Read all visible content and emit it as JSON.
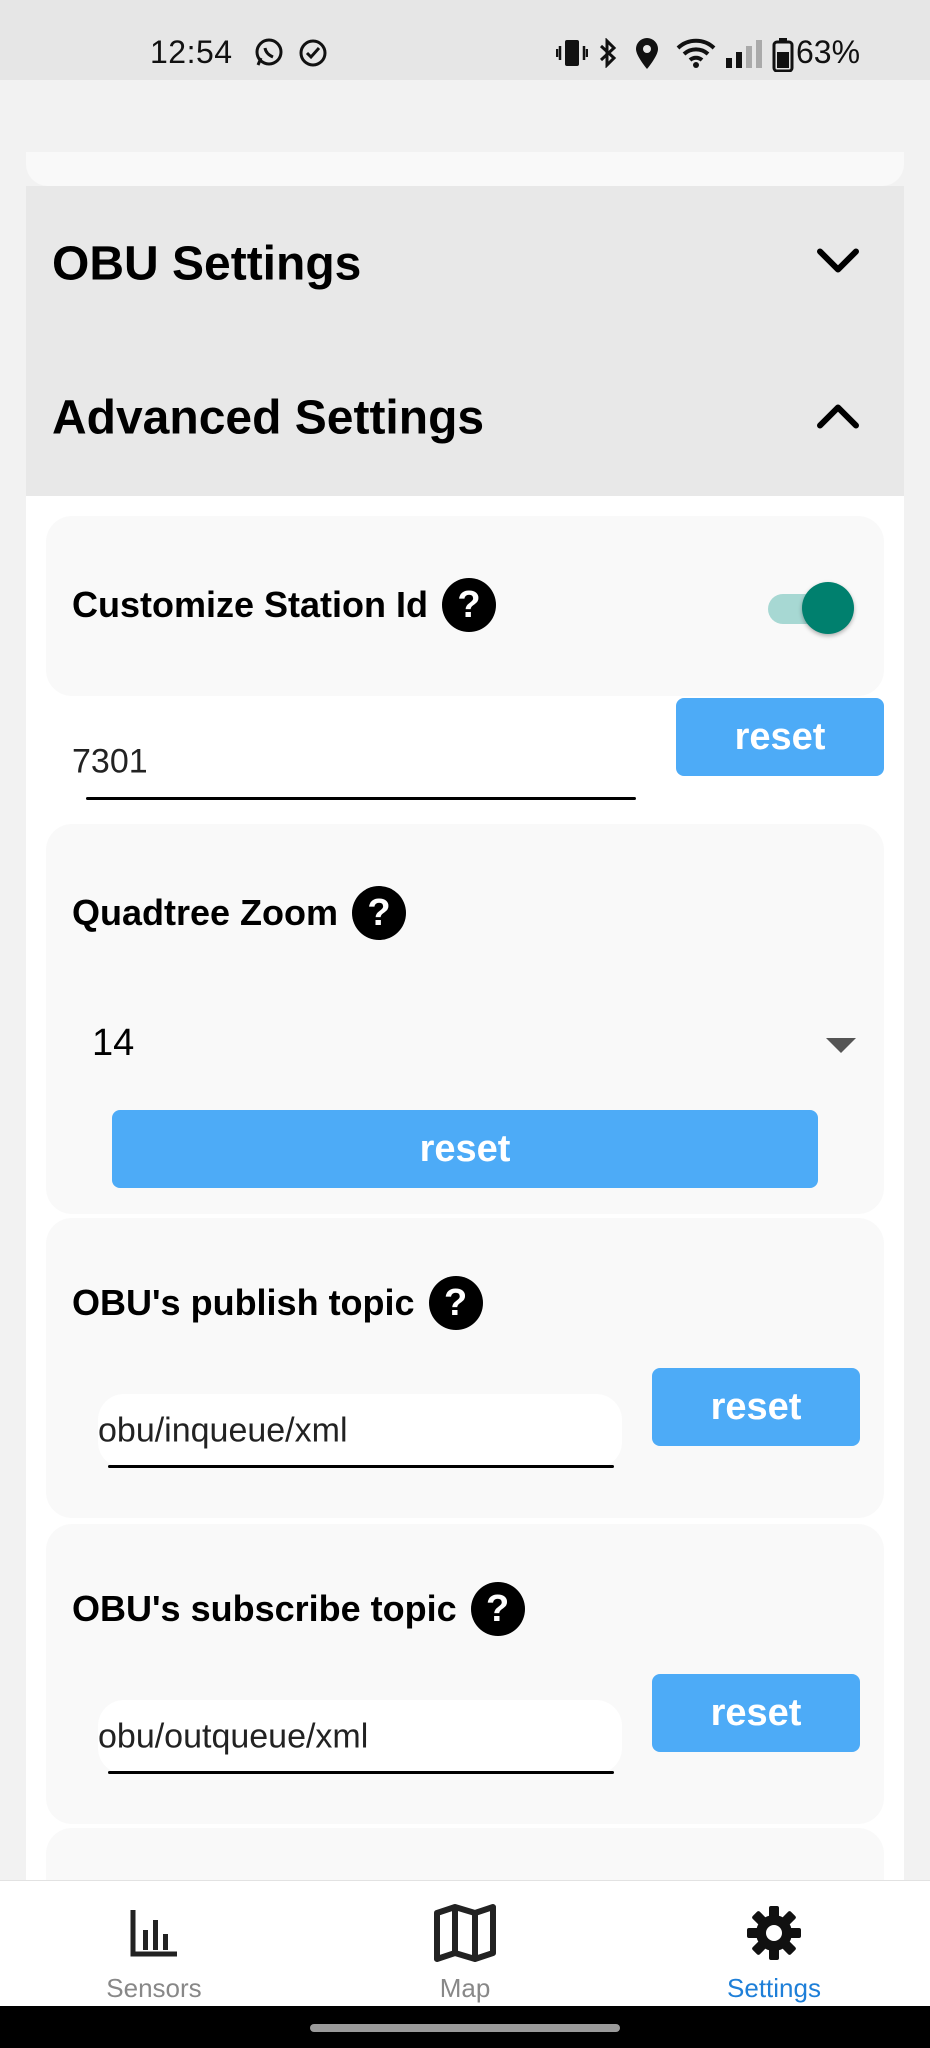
{
  "status_bar": {
    "time": "12:54",
    "battery": "63%",
    "left_icons": [
      "whatsapp-icon",
      "check-circle-icon"
    ],
    "right_icons": [
      "vibrate-icon",
      "bluetooth-icon",
      "location-icon",
      "wifi-icon",
      "signal-icon",
      "battery-icon"
    ]
  },
  "sections": {
    "obu_settings": {
      "title": "OBU Settings",
      "expanded": false
    },
    "advanced_settings": {
      "title": "Advanced Settings",
      "expanded": true
    }
  },
  "customize_station_id": {
    "label": "Customize Station Id",
    "enabled": true,
    "value": "7301",
    "reset_label": "reset"
  },
  "quadtree_zoom": {
    "label": "Quadtree Zoom",
    "selected": "14",
    "reset_label": "reset"
  },
  "publish_topic": {
    "label": "OBU's publish topic",
    "value": "obu/inqueue/xml",
    "reset_label": "reset"
  },
  "subscribe_topic": {
    "label": "OBU's subscribe topic",
    "value": "obu/outqueue/xml",
    "reset_label": "reset"
  },
  "bottom_nav": {
    "items": [
      {
        "label": "Sensors",
        "icon": "bar-chart-icon",
        "active": false
      },
      {
        "label": "Map",
        "icon": "map-icon",
        "active": false
      },
      {
        "label": "Settings",
        "icon": "gear-icon",
        "active": true
      }
    ]
  },
  "colors": {
    "accent_button": "#4dabf7",
    "toggle_on": "#00806e",
    "nav_active": "#1e7fd8"
  }
}
